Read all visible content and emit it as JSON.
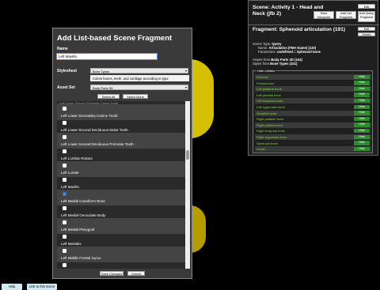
{
  "dialog": {
    "title": "Add List-based Scene Fragment",
    "name_label": "Name",
    "name_value": "Left Maxilla",
    "stylesheet_label": "Stylesheet",
    "stylesheet_value": "Bone Types",
    "stylesheet_desc": "Colors bones, teeth, and cartilage according to type",
    "assetset_label": "Asset Set",
    "assetset_value": "Body Parts 3D",
    "select_all": "Select All",
    "select_none": "Select None",
    "cut_text": "Left Lower Second Premolar Crown Tooth",
    "items": [
      {
        "label": "Left Lower Secondary Canine Tooth",
        "checked": false
      },
      {
        "label": "Left Lower Second Deciduous Molar Tooth",
        "checked": false
      },
      {
        "label": "Left Lower Second Deciduous Premolar Tooth",
        "checked": false
      },
      {
        "label": "Left Lumbar Rotator",
        "checked": false
      },
      {
        "label": "Left Lunate",
        "checked": false
      },
      {
        "label": "Left Maxilla",
        "checked": false
      },
      {
        "label": "Left Medial Cuneiform Bone",
        "checked": true
      },
      {
        "label": "Left Medial Geniculate Body",
        "checked": false
      },
      {
        "label": "Left Medial Pterygoid",
        "checked": false
      },
      {
        "label": "Left Mentalis",
        "checked": false
      },
      {
        "label": "Left Middle Frontal Gyrus",
        "checked": false
      },
      {
        "label": "Left Middle Temporal Gyrus",
        "checked": false
      }
    ],
    "save_label": "Save Changes",
    "cancel_label": "Cancel"
  },
  "scene": {
    "title": "Scene: Activity 1 - Head and Neck (jfb 2)",
    "save_viewpoint": "Save Viewpoint",
    "add_list_fragment": "Add List Fragment",
    "add_query_fragment": "Add Query Fragment",
    "edit": "Edit"
  },
  "fragment": {
    "title": "Fragment: Sphenoid articulation (191)",
    "edit": "Edit",
    "delete": "Delete",
    "scene_type_label": "Scene Type:",
    "scene_type_value": "Query",
    "name_label": "Name:",
    "name_value": "Articulation (FMA Name) (120)",
    "params_label": "Parameters:",
    "params_value": "undefined = Sphenoid bone",
    "assets_label": "Assets from",
    "assets_value": "Body Parts 3D (104)",
    "styles_label": "Styles from",
    "styles_value": "Bone Types (101)",
    "hide_legend": "Hide entities",
    "hide_button": "Hide",
    "entities": [
      "Ethmoid",
      "Frontal bone",
      "Left palatine bone",
      "Left parietal bone",
      "Left temporal bone",
      "Left zygomatic bone",
      "Occipital bone",
      "Right palatine bone",
      "Right parietal bone",
      "Right temporal bone",
      "Right zygomatic bone",
      "Sphenoid bone",
      "Vomer"
    ]
  },
  "bottom": {
    "help": "Help",
    "link": "Link to this scene"
  },
  "colors": {
    "entity_text": "#7ddc3a",
    "hide_button": "#2e8b2e",
    "dialog_bg": "#3a3a3a"
  }
}
